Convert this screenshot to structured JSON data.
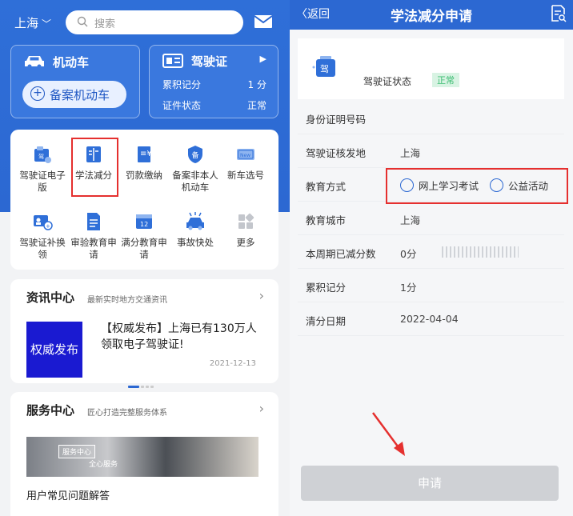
{
  "left": {
    "city": "上海",
    "search_placeholder": "搜索",
    "vehicle_card": {
      "title": "机动车",
      "button": "备案机动车"
    },
    "license_card": {
      "title": "驾驶证",
      "points_label": "累积记分",
      "points_value": "1 分",
      "status_label": "证件状态",
      "status_value": "正常"
    },
    "grid": [
      {
        "label": "驾驶证电子版",
        "icon": "id-card-icon"
      },
      {
        "label": "学法减分",
        "icon": "book-icon"
      },
      {
        "label": "罚款缴纳",
        "icon": "receipt-yen-icon"
      },
      {
        "label": "备案非本人机动车",
        "icon": "shield-bei-icon"
      },
      {
        "label": "新车选号",
        "icon": "new-plate-icon"
      },
      {
        "label": "驾驶证补换领",
        "icon": "license-reissue-icon"
      },
      {
        "label": "审验教育申请",
        "icon": "document-icon"
      },
      {
        "label": "满分教育申请",
        "icon": "calendar-12-icon"
      },
      {
        "label": "事故快处",
        "icon": "car-accident-icon"
      },
      {
        "label": "更多",
        "icon": "more-grid-icon"
      }
    ],
    "news": {
      "title": "资讯中心",
      "subtitle": "最新实时地方交通资讯",
      "image_text": "权威发布",
      "headline": "【权威发布】上海已有130万人领取电子驾驶证!",
      "date": "2021-12-13"
    },
    "service": {
      "title": "服务中心",
      "subtitle": "匠心打造完整服务体系",
      "banner_tag": "服务中心",
      "banner_text": "全心服务",
      "faq": "用户常见问题解答"
    }
  },
  "right": {
    "back": "返回",
    "title": "学法减分申请",
    "status_label": "驾驶证状态",
    "status_tag": "正常",
    "badge_char": "驾",
    "rows": {
      "id_label": "身份证明号码",
      "origin_label": "驾驶证核发地",
      "origin_value": "上海",
      "edu_label": "教育方式",
      "edu_option1": "网上学习考试",
      "edu_option2": "公益活动",
      "city_label": "教育城市",
      "city_value": "上海",
      "week_label": "本周期已减分数",
      "week_value": "0分",
      "points_label": "累积记分",
      "points_value": "1分",
      "clear_label": "清分日期",
      "clear_value": "2022-04-04"
    },
    "apply_button": "申请"
  },
  "colors": {
    "brand_blue": "#2c68d2",
    "highlight_red": "#e5302f",
    "status_green": "#3cbd72"
  }
}
